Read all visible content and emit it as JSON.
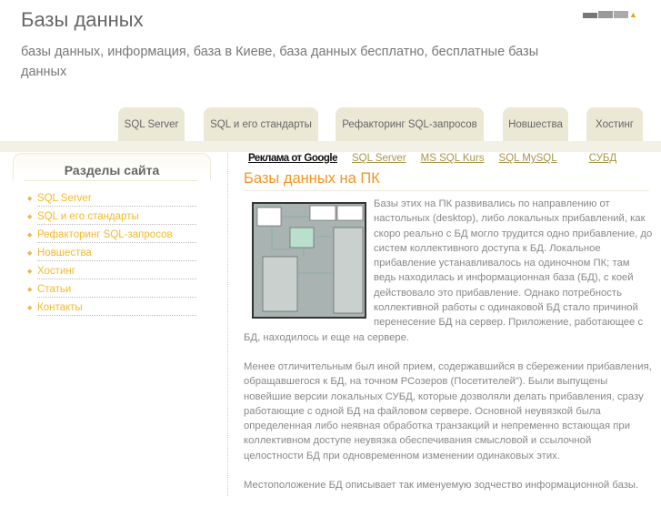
{
  "header": {
    "title": "Базы данных",
    "subtitle": "базы данных, информация, база в Киеве, база данных бесплатно, бесплатные базы данных"
  },
  "nav": {
    "tabs": [
      "SQL Server",
      "SQL и его стандарты",
      "Рефакторинг SQL-запросов",
      "Новшества",
      "Хостинг"
    ]
  },
  "sidebar": {
    "title": "Разделы сайта",
    "items": [
      "SQL Server",
      "SQL и его стандарты",
      "Рефакторинг SQL-запросов",
      "Новшества",
      "Хостинг",
      "Статьи",
      "Контакты"
    ]
  },
  "ads": {
    "label": "Реклама от Google",
    "links": [
      "SQL Server",
      "MS SQL Kurs",
      "SQL MySQL",
      "СУБД"
    ]
  },
  "article": {
    "title": "Базы данных на ПК",
    "paragraphs": [
      "Базы этих на ПК развивались по направлению от настольных (desktop), либо локальных прибавлений, как скоро реально с БД могло трудится одно прибавление, до систем коллективного доступа к БД. Локальное прибавление устанавливалось на одиночном ПК; там ведь находилась и информационная база (БД), с коей действовало это прибавление. Однако потребность коллективной работы с одинаковой БД стало причиной перенесение БД на сервер. Приложение, работающее с БД, находилось и еще на сервере.",
      "Менее отличительным был иной прием, содержавшийся в сбережении прибавления, обращавшегося к БД, на точном РСозеров (Посетителей\"). Были выпущены новейшие версии локальных СУБД, которые дозволяли делать прибавления, сразу работающие с одной БД на файловом сервере. Основной неувязкой была определенная либо неявная обработка транзакций и непременно встающая при коллективном доступе неувязка обеспечивания смысловой и ссылочной целостности БД при одновременном изменении одинаковых этих.",
      "Местоположение БД описывает так именуемую зодчество информационной базы."
    ]
  },
  "colors": {
    "accent": "#f7941d",
    "link": "#f5b82e",
    "tab": "#ece8d6"
  }
}
